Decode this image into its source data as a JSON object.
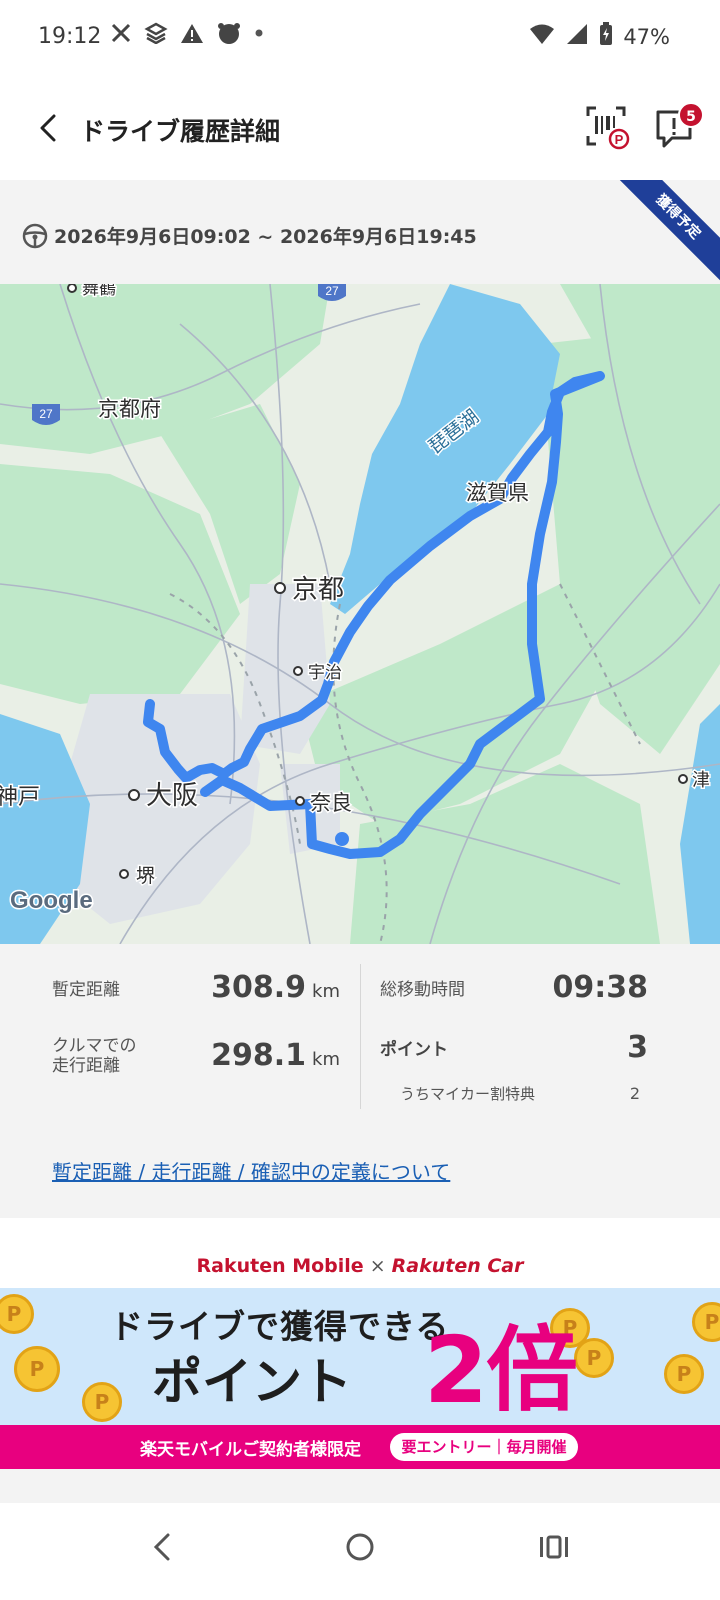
{
  "status_bar": {
    "time": "19:12",
    "battery": "47%"
  },
  "app_bar": {
    "title": "ドライブ履歴詳細",
    "notification_count": "5"
  },
  "summary": {
    "date_range": "2026年9月6日09:02 ~ 2026年9月6日19:45",
    "ribbon": "獲得予定"
  },
  "map": {
    "labels": {
      "maizuru": "舞鶴",
      "kyotofu": "京都府",
      "biwako": "琵琶湖",
      "shiga": "滋賀県",
      "kyoto": "京都",
      "uji": "宇治",
      "kobe": "神戸",
      "osaka": "大阪",
      "nara": "奈良",
      "tsu": "津",
      "sakai": "堺",
      "route27a": "27",
      "route27b": "27"
    },
    "attribution": "Google",
    "route_color": "#3f86ef"
  },
  "stats": {
    "provisional_distance": {
      "label": "暫定距離",
      "value": "308.9",
      "unit": "km"
    },
    "car_distance": {
      "label_line1": "クルマでの",
      "label_line2": "走行距離",
      "value": "298.1",
      "unit": "km"
    },
    "total_time": {
      "label": "総移動時間",
      "value": "09:38"
    },
    "points": {
      "label": "ポイント",
      "value": "3"
    },
    "mycar_discount": {
      "label": "うちマイカー割特典",
      "value": "2"
    },
    "definition_link": "暫定距離 / 走行距離 / 確認中の定義について"
  },
  "banner": {
    "rakuten_mobile": "Rakuten Mobile",
    "times": "×",
    "rakuten_car": "Rakuten Car",
    "headline": "ドライブで獲得できる",
    "point_word": "ポイント",
    "multiplier": "2倍",
    "footer": "楽天モバイルご契約者様限定",
    "pill": "要エントリー｜毎月開催",
    "coin_symbol": "P"
  }
}
